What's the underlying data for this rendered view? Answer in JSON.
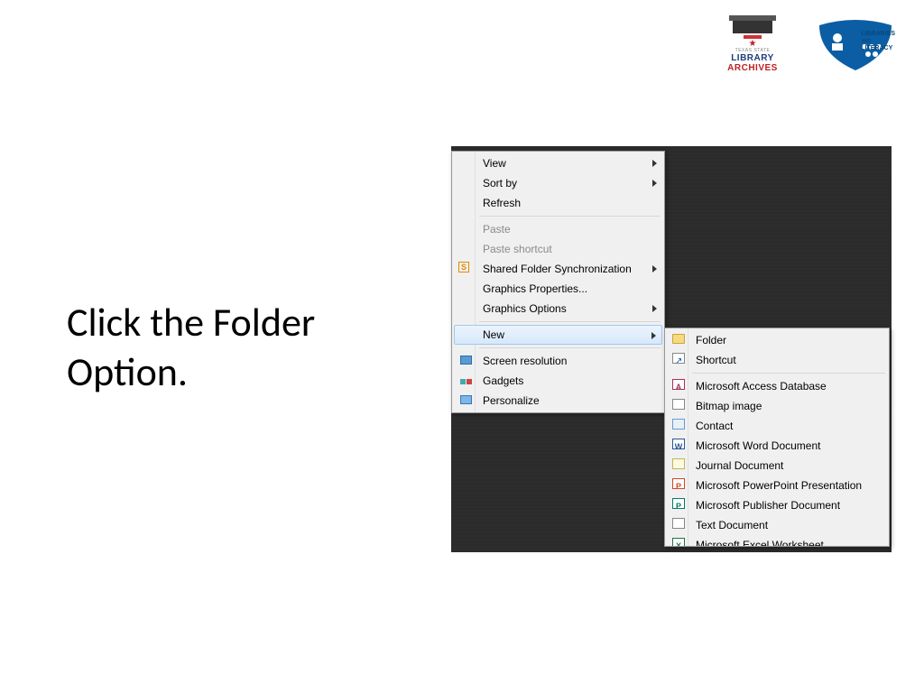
{
  "logos": {
    "library_archives": {
      "line1": "TEXAS STATE",
      "line2": "LIBRARY",
      "line3": "ARCHIVES"
    },
    "libraries_literacy": {
      "line1": "LIBRARIES",
      "line2": "AND",
      "line3": "LITERACY"
    }
  },
  "instruction": "Click the Folder Option.",
  "context_menu": {
    "items": [
      {
        "label": "View",
        "submenu": true
      },
      {
        "label": "Sort by",
        "submenu": true
      },
      {
        "label": "Refresh"
      },
      {
        "sep": true
      },
      {
        "label": "Paste",
        "disabled": true
      },
      {
        "label": "Paste shortcut",
        "disabled": true
      },
      {
        "label": "Shared Folder Synchronization",
        "submenu": true,
        "icon": "sync"
      },
      {
        "label": "Graphics Properties..."
      },
      {
        "label": "Graphics Options",
        "submenu": true
      },
      {
        "sep": true
      },
      {
        "label": "New",
        "submenu": true,
        "highlight": true
      },
      {
        "sep": true
      },
      {
        "label": "Screen resolution",
        "icon": "monitor"
      },
      {
        "label": "Gadgets",
        "icon": "gadgets"
      },
      {
        "label": "Personalize",
        "icon": "personalize"
      }
    ]
  },
  "submenu_new": {
    "items": [
      {
        "label": "Folder",
        "icon": "folder"
      },
      {
        "label": "Shortcut",
        "icon": "shortcut"
      },
      {
        "sep": true
      },
      {
        "label": "Microsoft Access Database",
        "icon": "access"
      },
      {
        "label": "Bitmap image",
        "icon": "bitmap"
      },
      {
        "label": "Contact",
        "icon": "contact"
      },
      {
        "label": "Microsoft Word Document",
        "icon": "word"
      },
      {
        "label": "Journal Document",
        "icon": "journal"
      },
      {
        "label": "Microsoft PowerPoint Presentation",
        "icon": "ppt"
      },
      {
        "label": "Microsoft Publisher Document",
        "icon": "publisher"
      },
      {
        "label": "Text Document",
        "icon": "text"
      },
      {
        "label": "Microsoft Excel Worksheet",
        "icon": "excel"
      }
    ]
  }
}
